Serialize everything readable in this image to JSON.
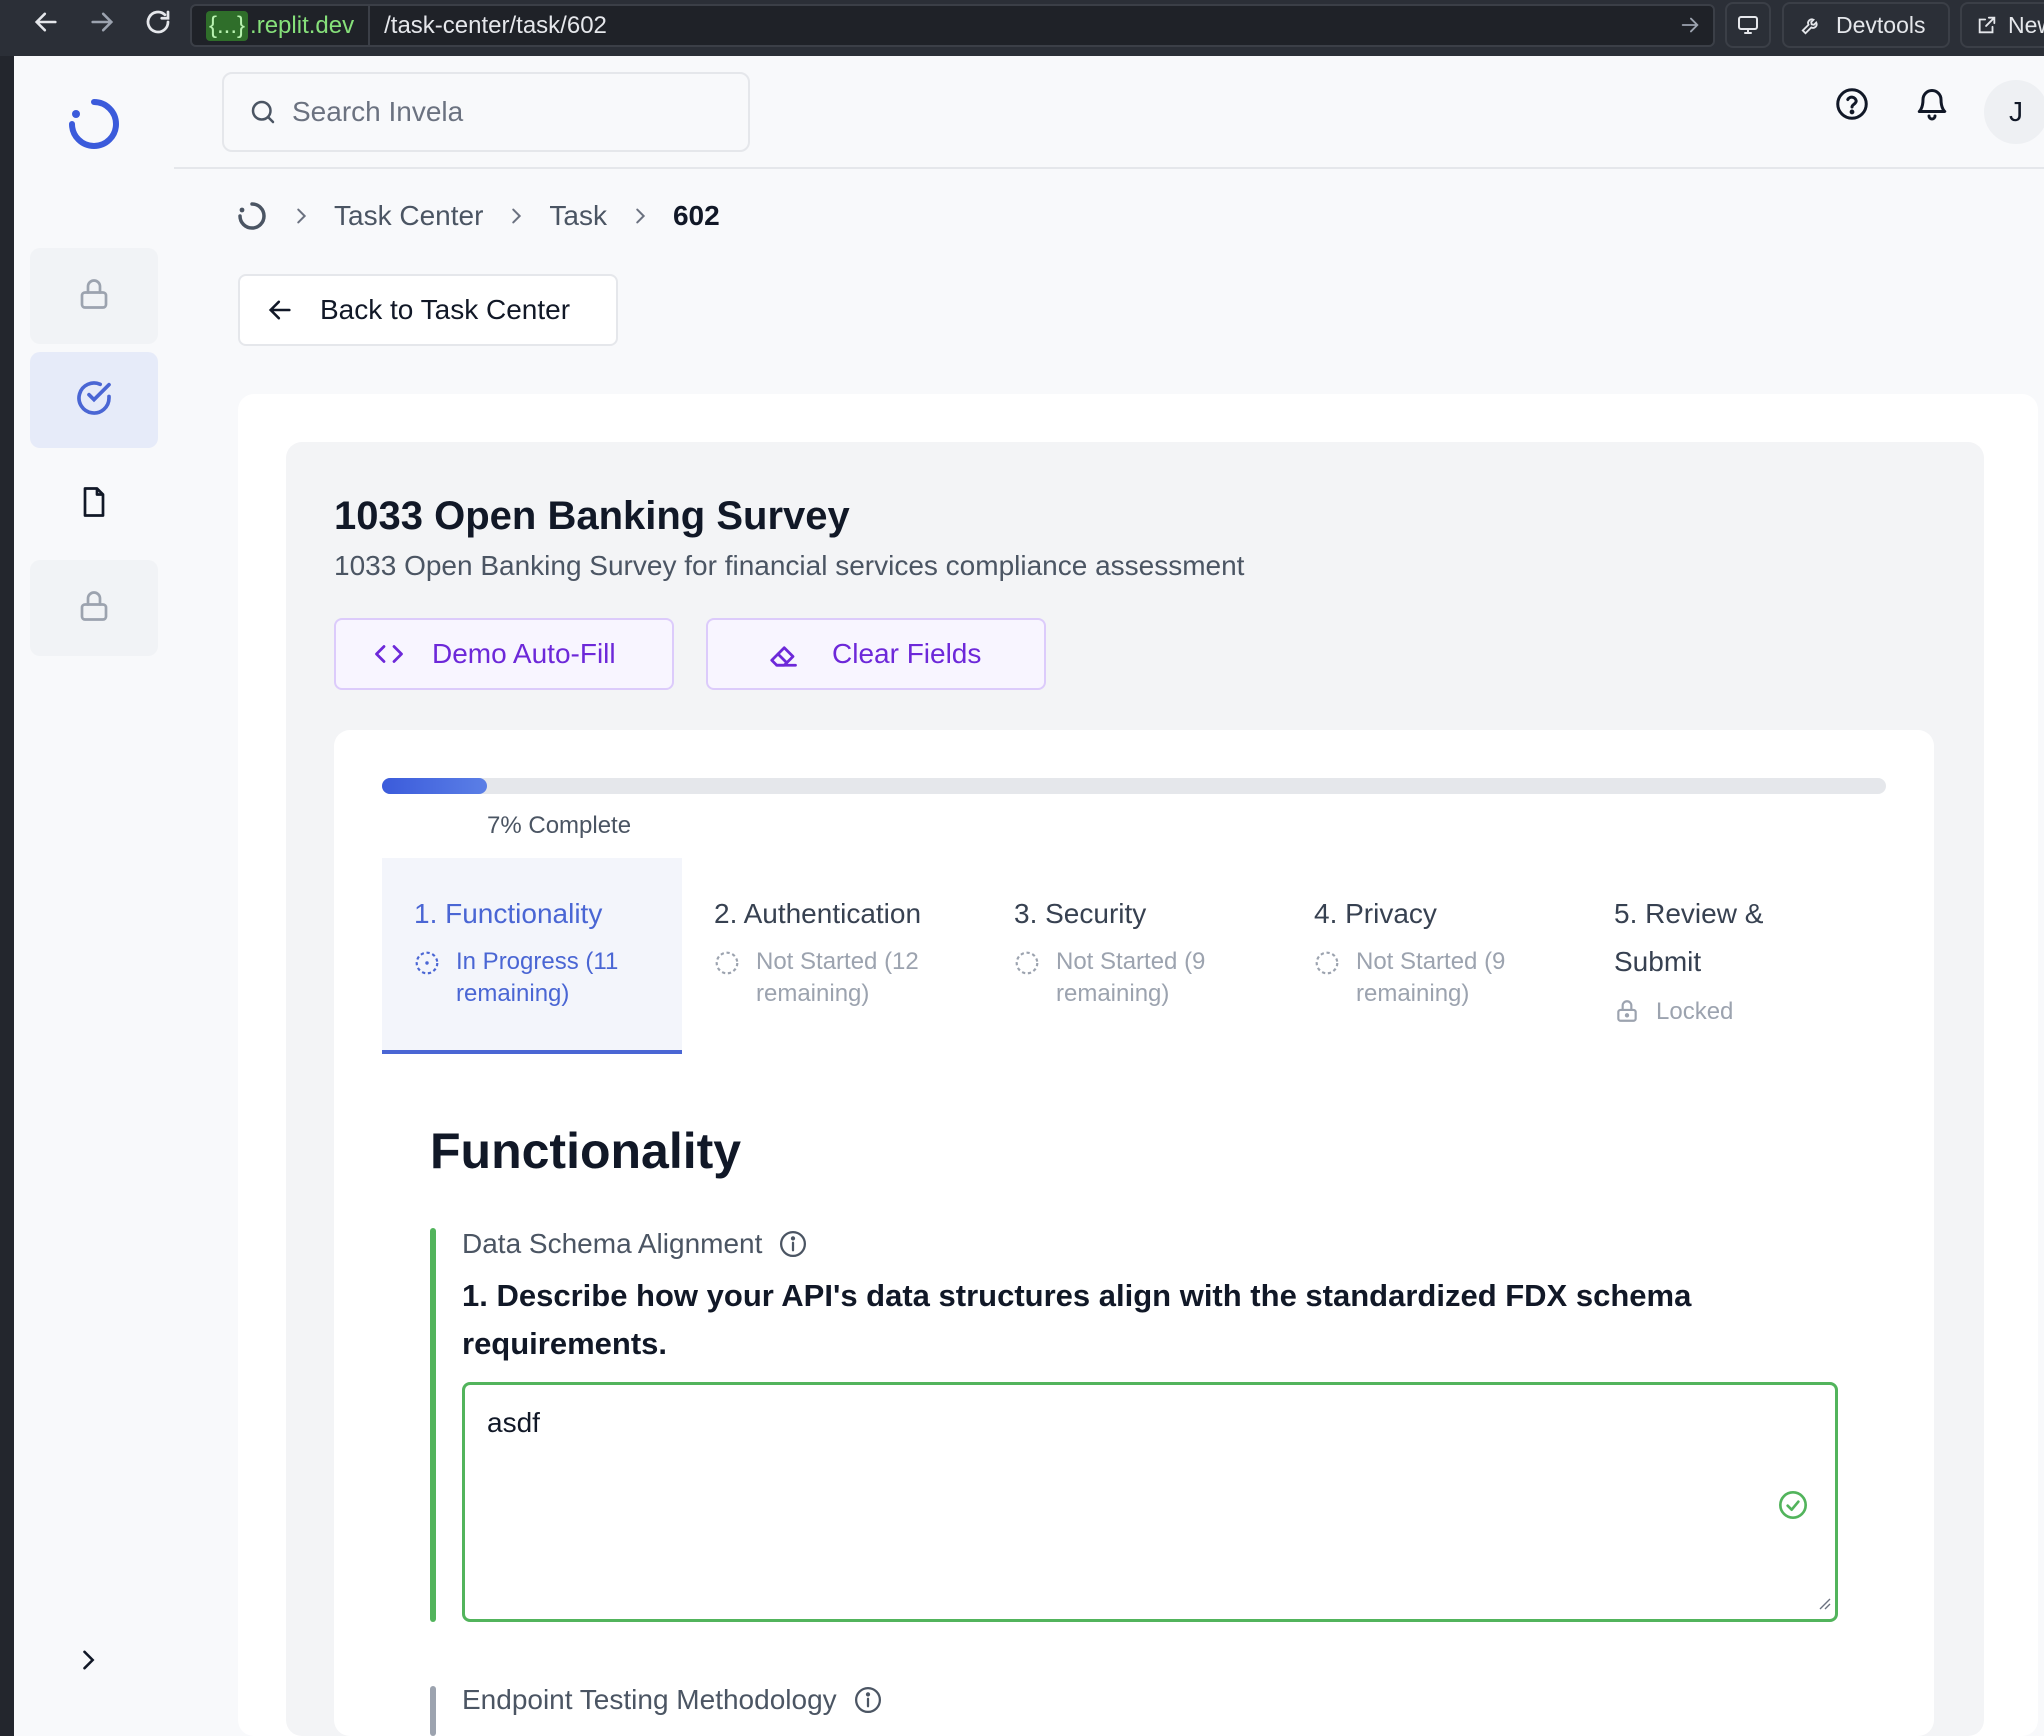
{
  "browser": {
    "url_host_badge": "{...}",
    "url_host": ".replit.dev",
    "url_path": "/task-center/task/602",
    "devtools_label": "Devtools",
    "new_label": "New"
  },
  "header": {
    "search_placeholder": "Search Invela",
    "avatar_initial": "J"
  },
  "breadcrumb": {
    "items": [
      "Task Center",
      "Task"
    ],
    "current": "602"
  },
  "back_button": "Back to Task Center",
  "survey": {
    "title": "1033 Open Banking Survey",
    "subtitle": "1033 Open Banking Survey for financial services compliance assessment",
    "demo_autofill": "Demo Auto-Fill",
    "clear_fields": "Clear Fields",
    "progress_percent": 7,
    "progress_label": "7% Complete"
  },
  "steps": [
    {
      "title": "1. Functionality",
      "status": "In Progress (11 remaining)",
      "state": "in-progress"
    },
    {
      "title": "2. Authentication",
      "status": "Not Started (12 remaining)",
      "state": "not-started"
    },
    {
      "title": "3. Security",
      "status": "Not Started (9 remaining)",
      "state": "not-started"
    },
    {
      "title": "4. Privacy",
      "status": "Not Started (9 remaining)",
      "state": "not-started"
    },
    {
      "title": "5. Review & Submit",
      "status": "Locked",
      "state": "locked"
    }
  ],
  "section": {
    "title": "Functionality",
    "questions": [
      {
        "label": "Data Schema Alignment",
        "text": "1. Describe how your API's data structures align with the standardized FDX schema requirements.",
        "answer": "asdf"
      },
      {
        "label": "Endpoint Testing Methodology"
      }
    ]
  },
  "colors": {
    "accent": "#4a66d4",
    "purple": "#6d28d9",
    "success": "#52b45c"
  }
}
